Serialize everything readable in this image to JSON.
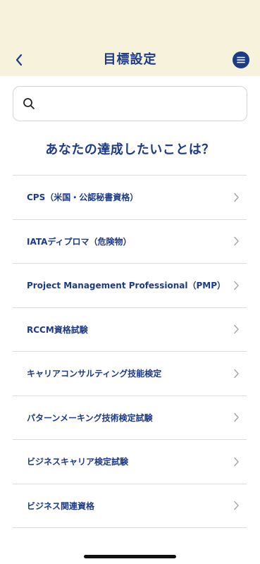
{
  "header": {
    "title": "目標設定",
    "back_icon": "chevron-left-icon",
    "menu_icon": "hamburger-menu-icon",
    "background": "#f6f2dc",
    "accent": "#1c3a86"
  },
  "search": {
    "value": "",
    "placeholder": "",
    "icon": "search-icon"
  },
  "question": "あなたの達成したいことは？",
  "goals": [
    {
      "label": "CPS（米国・公認秘書資格）"
    },
    {
      "label": "IATAディプロマ（危険物）"
    },
    {
      "label": "Project Management Professional（PMP）"
    },
    {
      "label": "RCCM資格試験"
    },
    {
      "label": "キャリアコンサルティング技能検定"
    },
    {
      "label": "パターンメーキング技術検定試験"
    },
    {
      "label": "ビジネスキャリア検定試験"
    },
    {
      "label": "ビジネス関連資格"
    }
  ]
}
